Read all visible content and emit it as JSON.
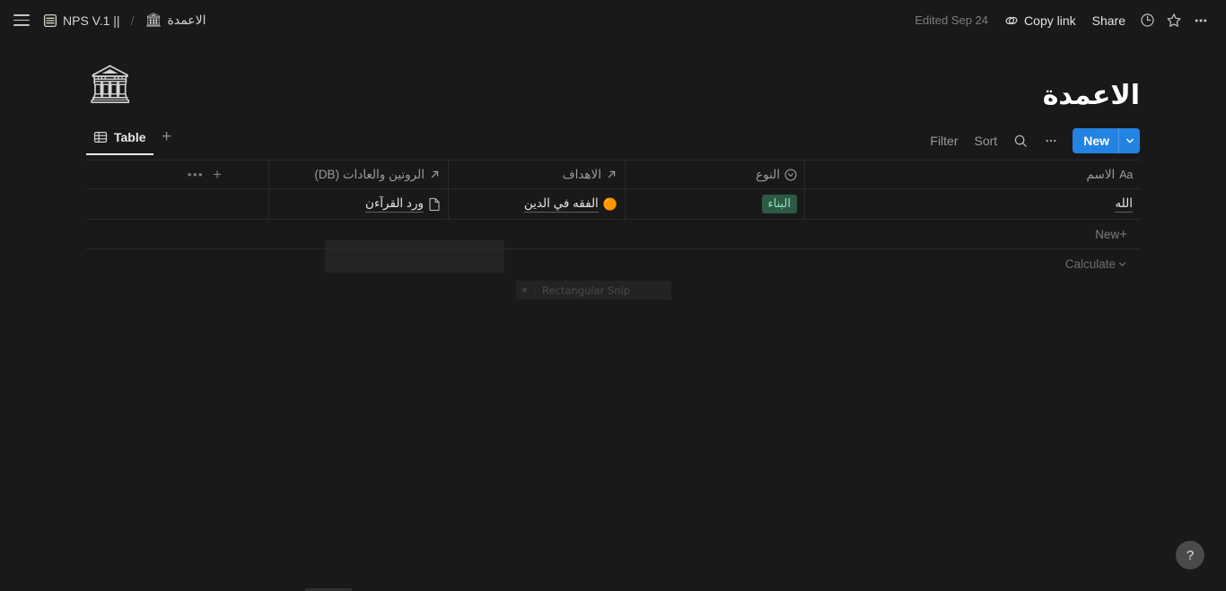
{
  "topbar": {
    "menu_icon": "hamburger-menu-icon",
    "breadcrumb": [
      {
        "icon": "database-icon",
        "label": "NPS V.1 ||"
      },
      {
        "icon": "classical-building-emoji",
        "emoji": "🏛",
        "label": "الاعمدة"
      }
    ],
    "separator": "/",
    "edited_label": "Edited Sep 24",
    "copy_link_label": "Copy link",
    "share_label": "Share",
    "history_icon": "clock-history-icon",
    "favorite_icon": "star-icon",
    "more_icon": "more-horizontal-icon"
  },
  "page": {
    "emoji": "🏛",
    "emoji_name": "classical-building-emoji",
    "title": "الاعمدة"
  },
  "view_toolbar": {
    "tabs": [
      {
        "label": "Table",
        "icon": "table-view-icon",
        "active": true
      }
    ],
    "add_view_label": "+",
    "filter_label": "Filter",
    "sort_label": "Sort",
    "search_icon": "search-icon",
    "more_icon": "more-horizontal-icon",
    "new_label": "New",
    "new_caret_icon": "chevron-down-icon",
    "accent_color": "#2383e2"
  },
  "table": {
    "columns": [
      {
        "key": "name",
        "label": "الاسم",
        "icon": "title-aa-icon"
      },
      {
        "key": "type",
        "label": "النوع",
        "icon": "select-circle-icon"
      },
      {
        "key": "goals",
        "label": "الاهداف",
        "icon": "relation-arrow-icon"
      },
      {
        "key": "routines",
        "label": "الروتين والعادات (DB)",
        "icon": "relation-arrow-icon"
      }
    ],
    "header_more_icon": "more-horizontal-icon",
    "header_add_icon": "add-column-icon",
    "rows": [
      {
        "name": "الله",
        "type": {
          "label": "البناء",
          "bg": "#2d5a45",
          "fg": "#8fe3b8"
        },
        "goals": {
          "emoji": "🟠",
          "emoji_name": "orange-circle-emoji",
          "label": "الفقه في الدين"
        },
        "routines": {
          "emoji": "📄",
          "emoji_name": "page-document-icon",
          "label": "ورد القرآءن"
        }
      }
    ],
    "new_row_label": "New",
    "new_row_icon": "plus-icon",
    "calculate_label": "Calculate",
    "calculate_icon": "chevron-down-icon"
  },
  "overlay": {
    "snip_label": "Rectangular Snip",
    "snip_dot": "mode-dot-icon"
  },
  "help": {
    "label": "?",
    "name": "help-button"
  }
}
